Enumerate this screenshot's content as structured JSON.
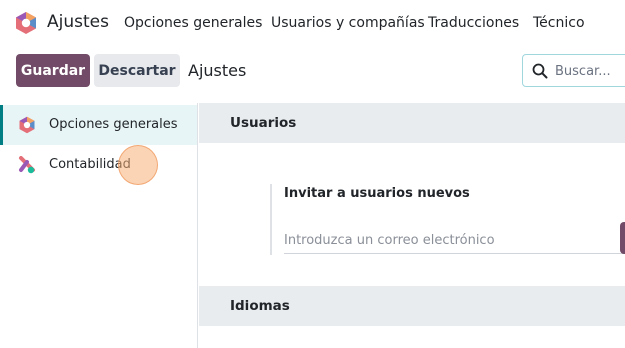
{
  "navbar": {
    "app_name": "Ajustes",
    "app_icon": "odoo-settings-icon",
    "menu": [
      "Opciones generales",
      "Usuarios y compañías",
      "Traducciones",
      "Técnico"
    ]
  },
  "control_panel": {
    "save_label": "Guardar",
    "discard_label": "Descartar",
    "breadcrumb": "Ajustes",
    "search_placeholder": "Buscar..."
  },
  "sidebar": {
    "items": [
      {
        "label": "Opciones generales",
        "icon": "general-settings-icon",
        "active": true
      },
      {
        "label": "Contabilidad",
        "icon": "accounting-icon",
        "active": false
      }
    ]
  },
  "main": {
    "sections": [
      {
        "title": "Usuarios"
      },
      {
        "title": "Idiomas"
      }
    ],
    "invite": {
      "title": "Invitar a usuarios nuevos",
      "placeholder": "Introduzca un correo electrónico"
    }
  },
  "colors": {
    "brand": "#714b67",
    "accent": "#017e84",
    "section_bg": "#e9ecef"
  }
}
